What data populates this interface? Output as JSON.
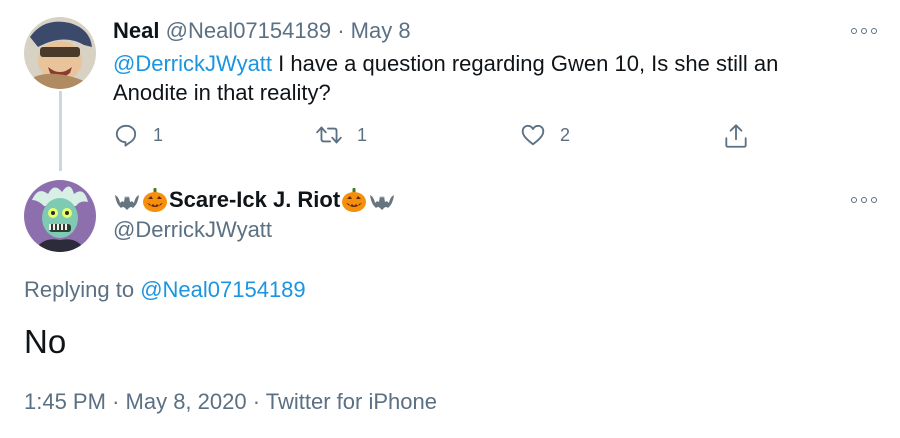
{
  "parent_tweet": {
    "name": "Neal",
    "handle": "@Neal07154189",
    "separator": "·",
    "date": "May 8",
    "mention": "@DerrickJWyatt",
    "text": " I have a question regarding Gwen 10, Is she still an Anodite in that reality?",
    "actions": {
      "reply_count": "1",
      "retweet_count": "1",
      "like_count": "2"
    }
  },
  "main_tweet": {
    "name": "Scare-Ick J. Riot",
    "name_emoji": [
      "bat",
      "jack-o-lantern",
      "jack-o-lantern",
      "bat"
    ],
    "handle": "@DerrickJWyatt",
    "replying_prefix": "Replying to ",
    "replying_to": "@Neal07154189",
    "text": "No",
    "time": "1:45 PM",
    "date": "May 8, 2020",
    "source": "Twitter for iPhone",
    "separator": "·"
  },
  "colors": {
    "link": "#1b95e0",
    "muted": "#5b7083",
    "text": "#0f1419",
    "thread_line": "#ccd6dd"
  },
  "icons": [
    "more-icon",
    "reply-icon",
    "retweet-icon",
    "like-icon",
    "share-icon"
  ]
}
